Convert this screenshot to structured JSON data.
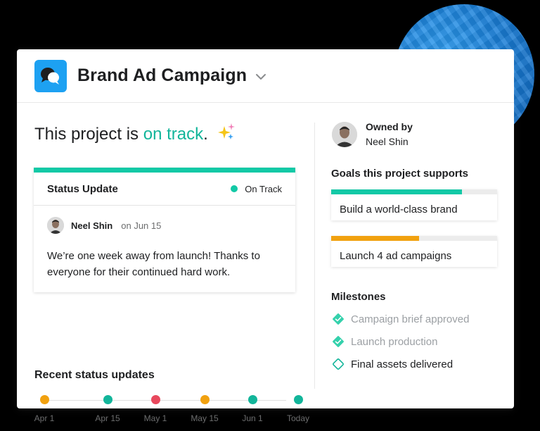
{
  "project": {
    "title": "Brand Ad Campaign",
    "headline_prefix": "This project is ",
    "headline_status": "on track",
    "headline_suffix": "."
  },
  "status_update": {
    "label": "Status Update",
    "status": "On Track",
    "author": "Neel Shin",
    "date": "on Jun 15",
    "body": "We’re one week away from launch! Thanks to everyone for their continued hard work."
  },
  "recent": {
    "title": "Recent status updates",
    "items": [
      {
        "label": "Apr 1",
        "color": "#f1a10f"
      },
      {
        "label": "Apr 15",
        "color": "#12b59a"
      },
      {
        "label": "May 1",
        "color": "#e8485d"
      },
      {
        "label": "May 15",
        "color": "#f1a10f"
      },
      {
        "label": "Jun 1",
        "color": "#12b59a"
      },
      {
        "label": "Today",
        "color": "#12b59a"
      }
    ]
  },
  "owner": {
    "label": "Owned by",
    "name": "Neel Shin"
  },
  "goals": {
    "title": "Goals this project supports",
    "items": [
      {
        "label": "Build a world-class brand",
        "progress": 0.79,
        "color": "#12c9a6"
      },
      {
        "label": "Launch 4 ad campaigns",
        "progress": 0.53,
        "color": "#f1a10f"
      }
    ]
  },
  "milestones": {
    "title": "Milestones",
    "items": [
      {
        "label": "Campaign brief approved",
        "done": true
      },
      {
        "label": "Launch production",
        "done": true
      },
      {
        "label": "Final assets delivered",
        "done": false
      }
    ]
  },
  "colors": {
    "accent": "#12b59a",
    "app_icon": "#1da1f2",
    "blob": "#1a7fd8"
  },
  "icons": {
    "app": "chat-bubbles-icon",
    "title_menu": "chevron-down-icon",
    "sparkle": "sparkle-icon",
    "milestone_done": "diamond-check-icon",
    "milestone_todo": "diamond-outline-icon"
  }
}
